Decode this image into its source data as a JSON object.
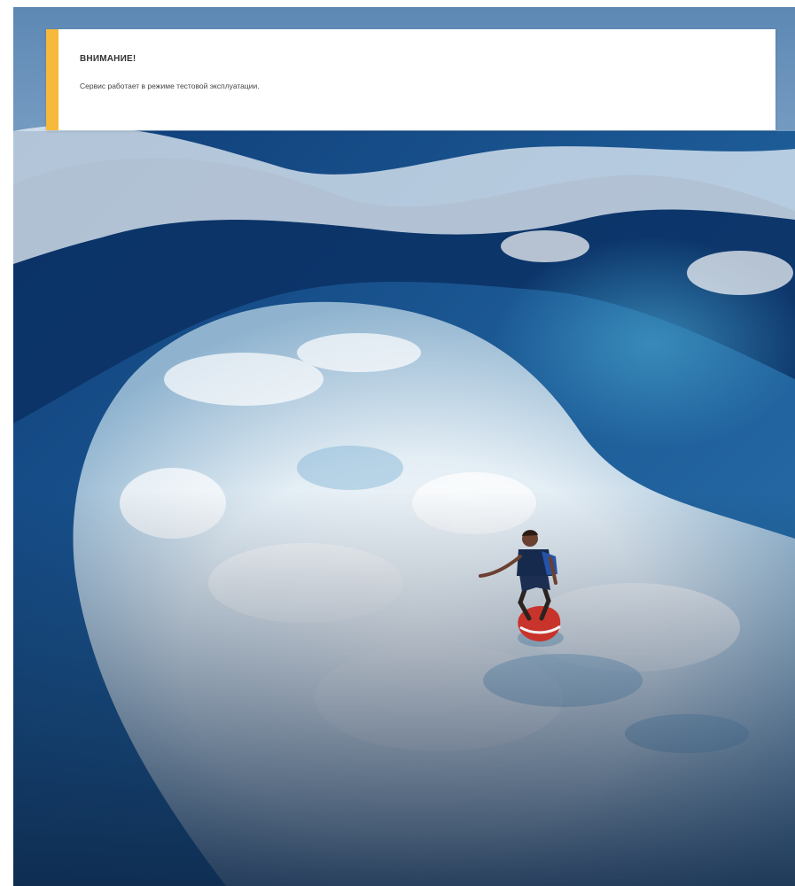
{
  "notice": {
    "title": "ВНИМАНИЕ!",
    "message": "Сервис работает в режиме тестовой эксплуатации.",
    "accent_color": "#f6b93b"
  },
  "hero": {
    "image": "surfer-on-ocean-wave"
  },
  "colors": {
    "background": "#ffffff",
    "ocean_dark": "#123a6e",
    "ocean_mid": "#2f6fa8",
    "foam": "#e8f2f8"
  }
}
